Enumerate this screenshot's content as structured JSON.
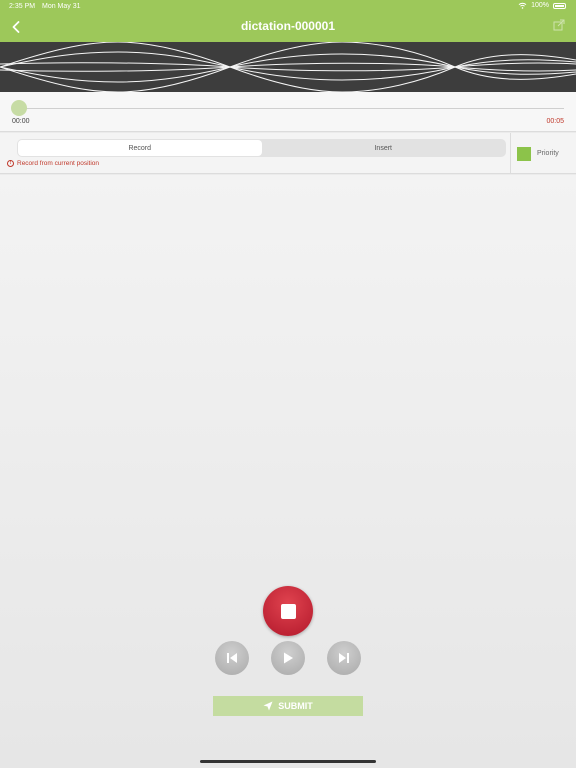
{
  "status_bar": {
    "time": "2:35 PM",
    "date": "Mon May 31",
    "battery": "100%"
  },
  "header": {
    "title": "dictation-000001"
  },
  "timeline": {
    "elapsed": "00:00",
    "total": "00:05"
  },
  "mode": {
    "options": [
      "Record",
      "Insert"
    ],
    "selected": "Record",
    "hint": "Record from current position"
  },
  "priority": {
    "label": "Priority",
    "color": "#8cc34a"
  },
  "actions": {
    "submit_label": "SUBMIT"
  },
  "colors": {
    "accent": "#9dc85a",
    "record": "#c8202f",
    "alert": "#c0392b"
  }
}
